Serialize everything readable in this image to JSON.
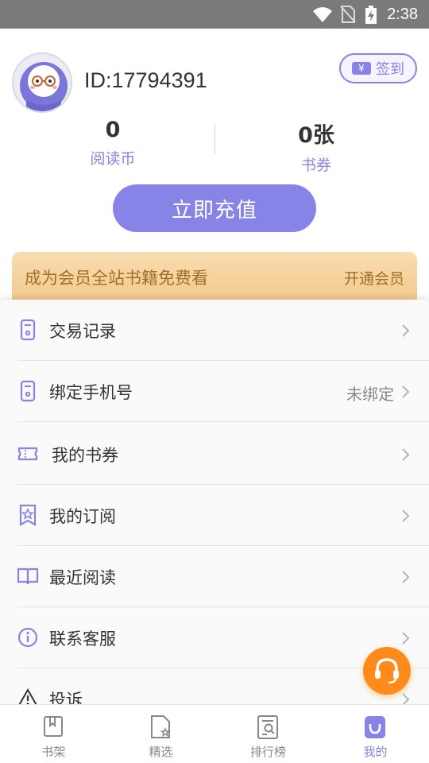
{
  "status_bar": {
    "time": "2:38"
  },
  "profile": {
    "user_id": "ID:17794391",
    "checkin_label": "签到",
    "checkin_icon_symbol": "¥"
  },
  "stats": {
    "coins": {
      "value": "0",
      "label": "阅读币"
    },
    "tickets": {
      "value": "0张",
      "label": "书券"
    }
  },
  "recharge_label": "立即充值",
  "vip_banner": {
    "text": "成为会员全站书籍免费看",
    "action": "开通会员"
  },
  "menu": [
    {
      "label": "交易记录",
      "icon": "receipt-icon",
      "value": ""
    },
    {
      "label": "绑定手机号",
      "icon": "phone-icon",
      "value": "未绑定"
    },
    {
      "label": "我的书券",
      "icon": "ticket-icon",
      "value": ""
    },
    {
      "label": "我的订阅",
      "icon": "subscribe-star-icon",
      "value": ""
    },
    {
      "label": "最近阅读",
      "icon": "book-open-icon",
      "value": ""
    },
    {
      "label": "联系客服",
      "icon": "info-icon",
      "value": ""
    },
    {
      "label": "投诉",
      "icon": "warning-icon",
      "value": ""
    }
  ],
  "bottom_nav": [
    {
      "label": "书架",
      "icon": "bookshelf-icon",
      "active": false
    },
    {
      "label": "精选",
      "icon": "featured-doc-icon",
      "active": false
    },
    {
      "label": "排行榜",
      "icon": "ranking-icon",
      "active": false
    },
    {
      "label": "我的",
      "icon": "profile-icon",
      "active": true
    }
  ],
  "colors": {
    "accent": "#8883e6",
    "vip_text": "#a36d2c",
    "fab": "#ff8c1a"
  }
}
